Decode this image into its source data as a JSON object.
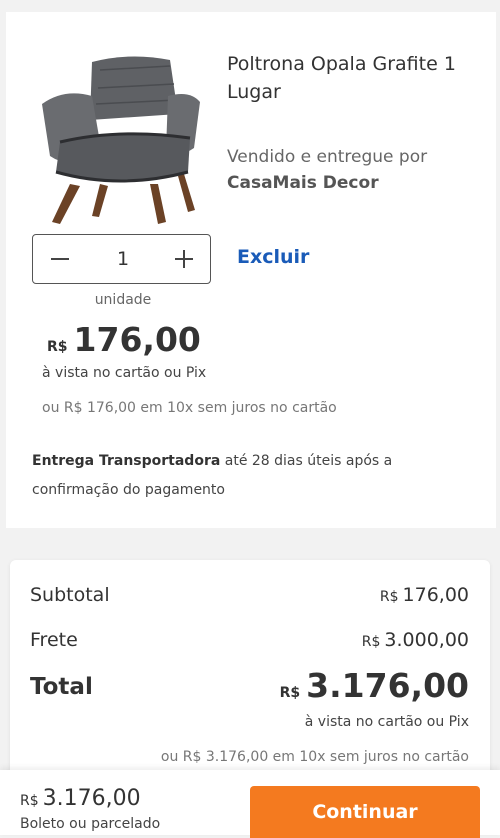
{
  "product": {
    "title": "Poltrona Opala Grafite 1 Lugar",
    "seller_prefix": "Vendido e entregue por",
    "seller_name": "CasaMais Decor",
    "quantity": "1",
    "remove_label": "Excluir",
    "unit_label": "unidade",
    "price_currency": "R$",
    "price_value": "176,00",
    "cash_note": "à vista no cartão ou Pix",
    "installments": "ou R$ 176,00 em 10x sem juros no cartão",
    "delivery_bold": "Entrega Transportadora",
    "delivery_text": " até 28 dias úteis após a confirmação do pagamento"
  },
  "summary": {
    "subtotal_label": "Subtotal",
    "subtotal_currency": "R$",
    "subtotal_value": "176,00",
    "shipping_label": "Frete",
    "shipping_currency": "R$",
    "shipping_value": "3.000,00",
    "total_label": "Total",
    "total_currency": "R$",
    "total_value": "3.176,00",
    "cash_note": "à vista no cartão ou Pix",
    "installments": "ou R$ 3.176,00 em 10x sem juros no cartão"
  },
  "bottom_bar": {
    "currency": "R$",
    "value": "3.176,00",
    "note": "Boleto ou parcelado",
    "continue_label": "Continuar"
  },
  "colors": {
    "accent_link": "#1a5bb8",
    "primary_button": "#f47a1f"
  }
}
